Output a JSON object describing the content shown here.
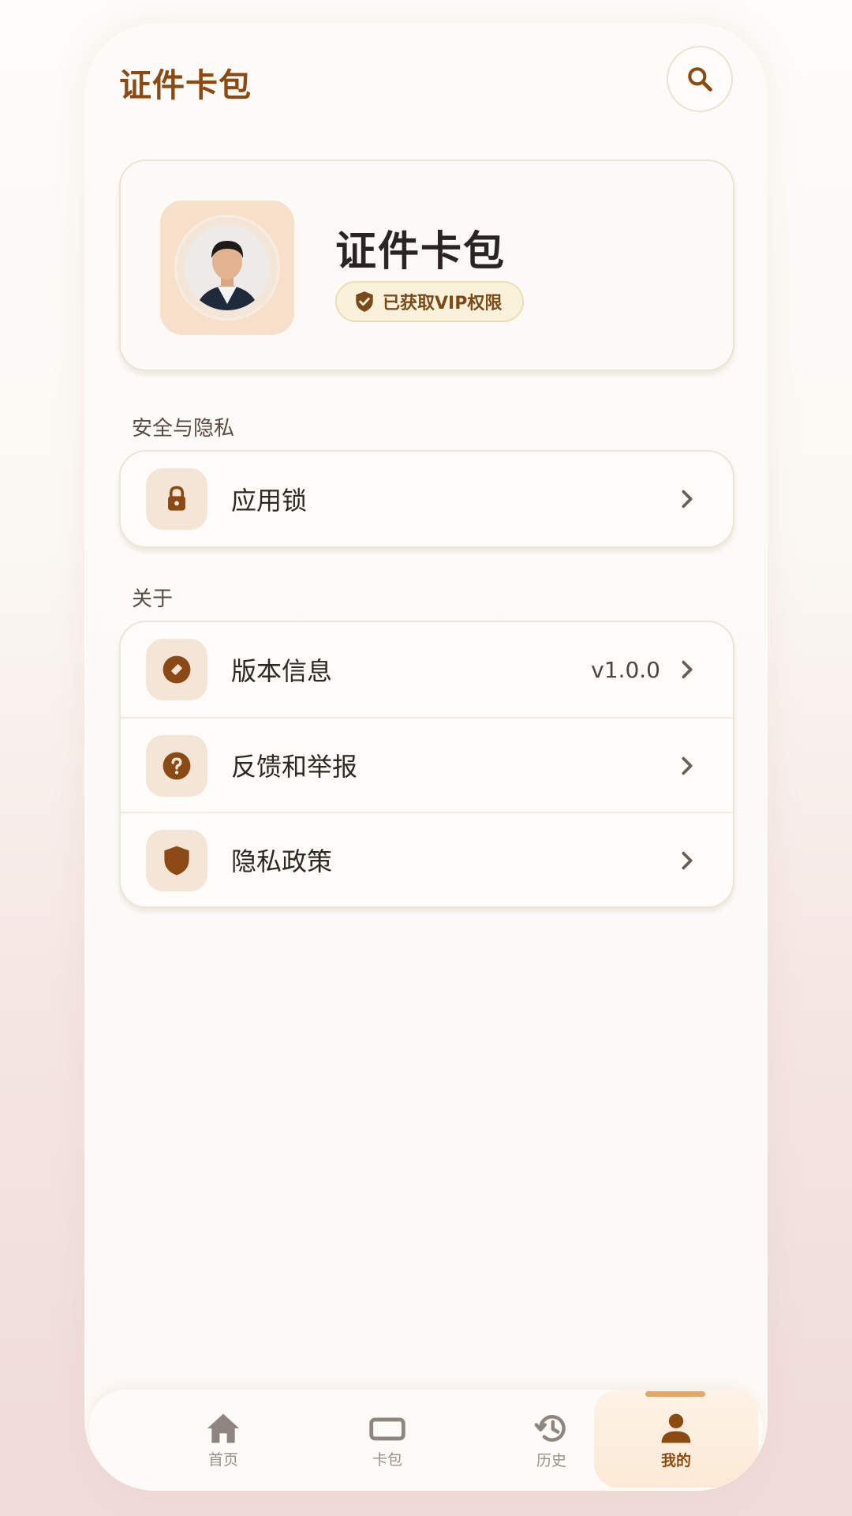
{
  "header": {
    "title": "证件卡包"
  },
  "profile": {
    "name": "证件卡包",
    "vip_label": "已获取VIP权限"
  },
  "sections": {
    "security_label": "安全与隐私",
    "about_label": "关于"
  },
  "security_items": [
    {
      "label": "应用锁",
      "icon": "lock-icon"
    }
  ],
  "about_items": [
    {
      "label": "版本信息",
      "value": "v1.0.0",
      "icon": "version-tag-icon"
    },
    {
      "label": "反馈和举报",
      "icon": "help-question-icon"
    },
    {
      "label": "隐私政策",
      "icon": "shield-icon"
    }
  ],
  "nav": {
    "items": [
      {
        "label": "首页",
        "icon": "home-icon"
      },
      {
        "label": "卡包",
        "icon": "card-icon"
      },
      {
        "label": "历史",
        "icon": "history-icon"
      },
      {
        "label": "我的",
        "icon": "person-icon"
      }
    ],
    "active_index": 3
  },
  "colors": {
    "accent": "#8a4a12",
    "icon_brown": "#8b4a14",
    "active_indicator": "#e2a86a"
  }
}
